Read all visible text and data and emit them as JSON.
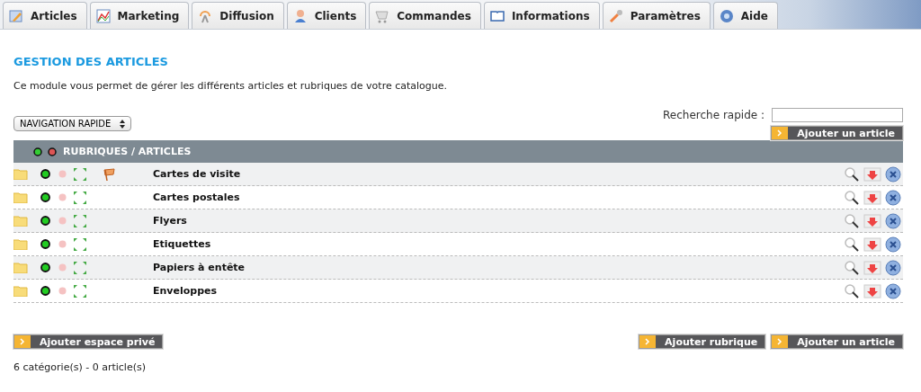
{
  "tabs": [
    {
      "label": "Articles"
    },
    {
      "label": "Marketing"
    },
    {
      "label": "Diffusion"
    },
    {
      "label": "Clients"
    },
    {
      "label": "Commandes"
    },
    {
      "label": "Informations"
    },
    {
      "label": "Paramètres"
    },
    {
      "label": "Aide"
    }
  ],
  "title": "GESTION DES ARTICLES",
  "description": "Ce module vous permet de gérer les différents articles et rubriques de votre catalogue.",
  "navigation": {
    "value": "NAVIGATION RAPIDE"
  },
  "search": {
    "label": "Recherche rapide :"
  },
  "top_button": "Ajouter un article",
  "table": {
    "header": "RUBRIQUES / ARTICLES",
    "rows": [
      {
        "name": "Cartes de visite",
        "online": true,
        "flagged": true
      },
      {
        "name": "Cartes postales",
        "online": true,
        "flagged": false
      },
      {
        "name": "Flyers",
        "online": true,
        "flagged": false
      },
      {
        "name": "Etiquettes",
        "online": true,
        "flagged": false
      },
      {
        "name": "Papiers à entête",
        "online": true,
        "flagged": false
      },
      {
        "name": "Enveloppes",
        "online": true,
        "flagged": false
      }
    ]
  },
  "bottom_left_button": "Ajouter espace privé",
  "bottom_right_buttons": [
    "Ajouter rubrique",
    "Ajouter un article"
  ],
  "summary": "6 catégorie(s) - 0 article(s)"
}
